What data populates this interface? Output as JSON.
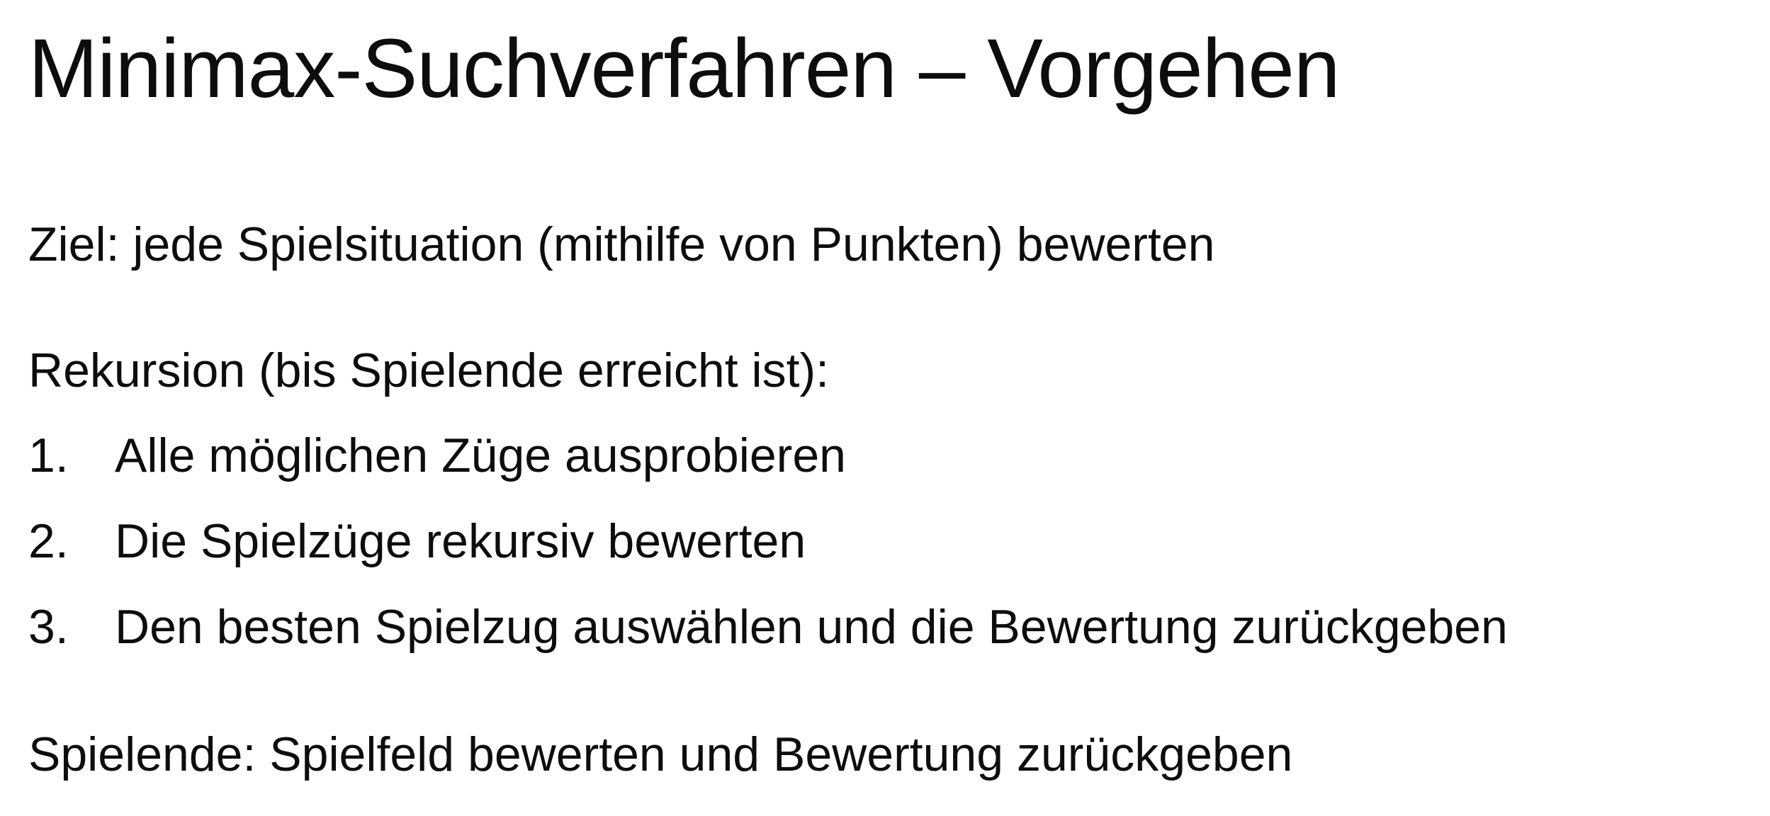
{
  "slide": {
    "title": "Minimax-Suchverfahren – Vorgehen",
    "goal": "Ziel: jede Spielsituation (mithilfe von Punkten) bewerten",
    "recursion_intro": "Rekursion (bis Spielende erreicht ist):",
    "steps": [
      {
        "number": "1.",
        "text": "Alle möglichen Züge ausprobieren"
      },
      {
        "number": "2.",
        "text": "Die Spielzüge rekursiv bewerten"
      },
      {
        "number": "3.",
        "text": "Den besten Spielzug auswählen und die Bewertung zurückgeben"
      }
    ],
    "game_end": "Spielende: Spielfeld bewerten und Bewertung zurückgeben"
  }
}
